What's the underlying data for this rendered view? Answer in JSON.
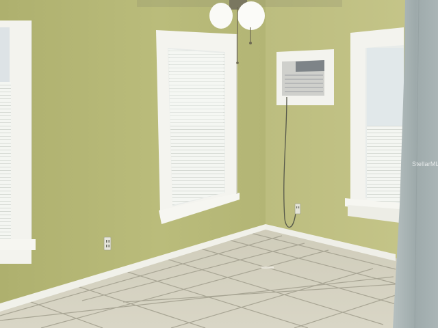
{
  "scene": {
    "description_free": true,
    "watermark_text": "StellarMLS",
    "colors": {
      "left_wall": "#b8ba78",
      "right_wall": "#c4c486",
      "trim": "#f4f4ee",
      "floor": "#d3d0c0",
      "grout": "#a8a594",
      "blind": "#f2f4f0",
      "curtain": "#a9b4b4",
      "ac_unit": "#cfd0cc"
    },
    "icons": [
      "ceiling-fan-light-icon",
      "wall-ac-unit-icon",
      "power-outlet-icon"
    ]
  }
}
